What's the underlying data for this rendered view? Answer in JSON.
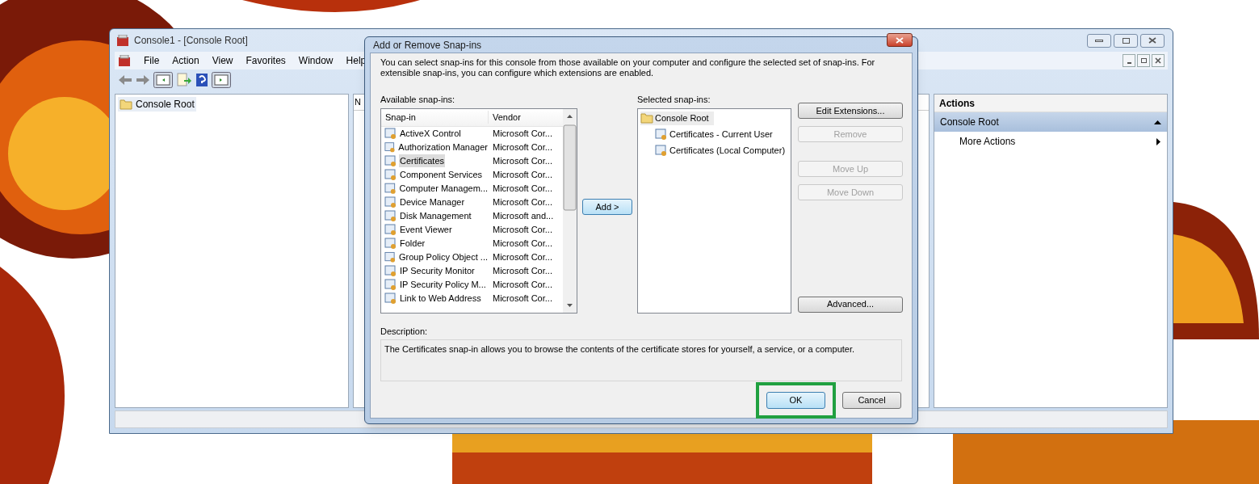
{
  "console_window": {
    "title": "Console1 - [Console Root]",
    "menu": [
      "File",
      "Action",
      "View",
      "Favorites",
      "Window",
      "Help"
    ],
    "tree": [
      {
        "label": "Console Root",
        "selected": true
      }
    ],
    "middle_pane": {
      "column_1": "N"
    },
    "actions_pane": {
      "title": "Actions",
      "section": "Console Root",
      "items": [
        "More Actions"
      ]
    }
  },
  "dialog": {
    "title": "Add or Remove Snap-ins",
    "intro": "You can select snap-ins for this console from those available on your computer and configure the selected set of snap-ins. For extensible snap-ins, you can configure which extensions are enabled.",
    "available_label": "Available snap-ins:",
    "columns": [
      "Snap-in",
      "Vendor"
    ],
    "available": [
      {
        "name": "ActiveX Control",
        "vendor": "Microsoft Cor...",
        "selected": false
      },
      {
        "name": "Authorization Manager",
        "vendor": "Microsoft Cor...",
        "selected": false
      },
      {
        "name": "Certificates",
        "vendor": "Microsoft Cor...",
        "selected": true
      },
      {
        "name": "Component Services",
        "vendor": "Microsoft Cor...",
        "selected": false
      },
      {
        "name": "Computer Managem...",
        "vendor": "Microsoft Cor...",
        "selected": false
      },
      {
        "name": "Device Manager",
        "vendor": "Microsoft Cor...",
        "selected": false
      },
      {
        "name": "Disk Management",
        "vendor": "Microsoft and...",
        "selected": false
      },
      {
        "name": "Event Viewer",
        "vendor": "Microsoft Cor...",
        "selected": false
      },
      {
        "name": "Folder",
        "vendor": "Microsoft Cor...",
        "selected": false
      },
      {
        "name": "Group Policy Object ...",
        "vendor": "Microsoft Cor...",
        "selected": false
      },
      {
        "name": "IP Security Monitor",
        "vendor": "Microsoft Cor...",
        "selected": false
      },
      {
        "name": "IP Security Policy M...",
        "vendor": "Microsoft Cor...",
        "selected": false
      },
      {
        "name": "Link to Web Address",
        "vendor": "Microsoft Cor...",
        "selected": false
      }
    ],
    "add_button": "Add >",
    "selected_label": "Selected snap-ins:",
    "selected_tree": [
      {
        "label": "Console Root",
        "selected": true,
        "children": [
          {
            "label": "Certificates - Current User",
            "selected": false
          },
          {
            "label": "Certificates (Local Computer)",
            "selected": false
          }
        ]
      }
    ],
    "side_buttons": [
      {
        "label": "Edit Extensions...",
        "disabled": false
      },
      {
        "label": "Remove",
        "disabled": true
      },
      {
        "label": "Move Up",
        "disabled": true
      },
      {
        "label": "Move Down",
        "disabled": true
      },
      {
        "label": "Advanced...",
        "disabled": false
      }
    ],
    "description_label": "Description:",
    "description": "The Certificates snap-in allows you to browse the contents of the certificate stores for yourself, a service, or a computer.",
    "buttons": [
      {
        "label": "OK",
        "highlighted": true
      },
      {
        "label": "Cancel",
        "highlighted": false
      }
    ]
  }
}
